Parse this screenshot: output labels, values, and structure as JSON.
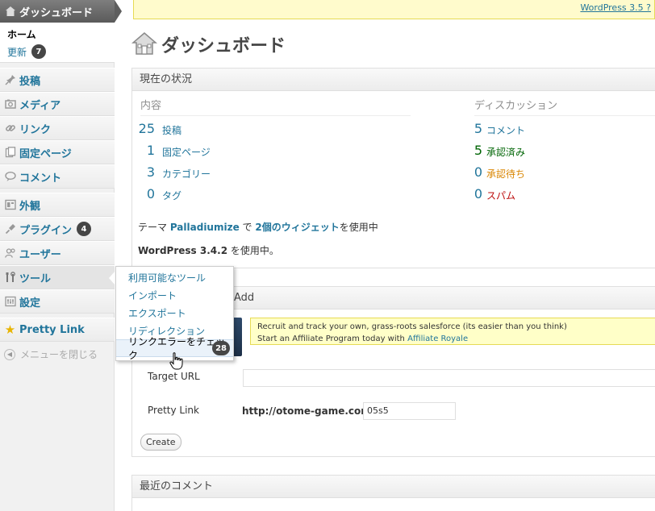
{
  "topbar": {
    "version_link": "WordPress 3.5 ?"
  },
  "sidebar": {
    "dashboard": "ダッシュボード",
    "home": "ホーム",
    "update_label": "更新",
    "update_count": "7",
    "items": [
      {
        "label": "投稿",
        "icon": "pin-icon"
      },
      {
        "label": "メディア",
        "icon": "media-icon"
      },
      {
        "label": "リンク",
        "icon": "link-icon"
      },
      {
        "label": "固定ページ",
        "icon": "pages-icon"
      },
      {
        "label": "コメント",
        "icon": "comment-icon"
      },
      {
        "label": "外観",
        "icon": "appearance-icon"
      },
      {
        "label": "プラグイン",
        "icon": "plugin-icon",
        "count": "4"
      },
      {
        "label": "ユーザー",
        "icon": "users-icon"
      },
      {
        "label": "ツール",
        "icon": "tools-icon"
      },
      {
        "label": "設定",
        "icon": "settings-icon"
      },
      {
        "label": "Pretty Link",
        "icon": "star-icon"
      }
    ],
    "collapse": "メニューを閉じる"
  },
  "flyout": {
    "items": [
      "利用可能なツール",
      "インポート",
      "エクスポート",
      "リディレクション",
      "リンクエラーをチェック"
    ],
    "badge": "28"
  },
  "main": {
    "page_title": "ダッシュボード",
    "status_box": {
      "title": "現在の状況",
      "content_head": "内容",
      "discussion_head": "ディスカッション",
      "content": [
        {
          "num": "25",
          "label": "投稿"
        },
        {
          "num": "1",
          "label": "固定ページ"
        },
        {
          "num": "3",
          "label": "カテゴリー"
        },
        {
          "num": "0",
          "label": "タグ"
        }
      ],
      "discussion": [
        {
          "num": "5",
          "label": "コメント"
        },
        {
          "num": "5",
          "label": "承認済み"
        },
        {
          "num": "0",
          "label": "承認待ち"
        },
        {
          "num": "0",
          "label": "スパム"
        }
      ],
      "theme_prefix": "テーマ ",
      "theme_name": "Palladiumize",
      "theme_mid": " で ",
      "widgets": "2個のウィジェット",
      "theme_suffix": "を使用中",
      "wp_version": "WordPress 3.4.2",
      "wp_suffix": " を使用中。"
    },
    "pretty_box": {
      "title": "Add",
      "banner_line1": "Recruit and track your own, grass-roots salesforce (its easier than you think)",
      "banner_line2_prefix": "Start an Affiliate Program today with ",
      "banner_link": "Affiliate Royale",
      "target_label": "Target URL",
      "target_value": "",
      "pretty_label": "Pretty Link",
      "host": "http://otome-game.com/",
      "slug": "05s5",
      "create_button": "Create"
    },
    "recent_box": {
      "title": "最近のコメント"
    }
  }
}
